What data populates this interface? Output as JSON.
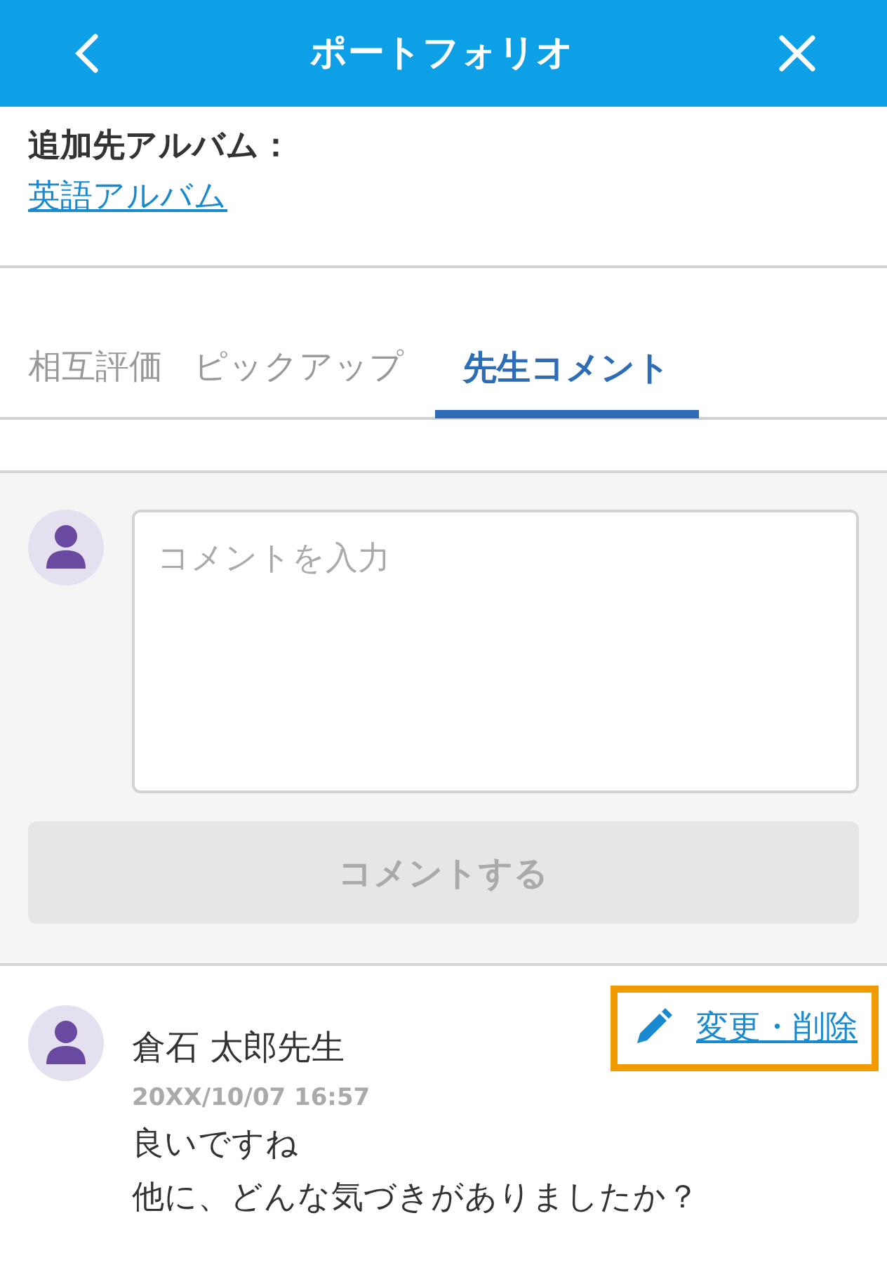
{
  "header": {
    "title": "ポートフォリオ"
  },
  "album": {
    "label": "追加先アルバム：",
    "link": "英語アルバム"
  },
  "tabs": [
    {
      "label": "相互評価",
      "selected": false
    },
    {
      "label": "ピックアップ",
      "selected": false
    },
    {
      "label": "先生コメント",
      "selected": true
    }
  ],
  "comment_form": {
    "placeholder": "コメントを入力",
    "submit": "コメントする",
    "submit_disabled": true
  },
  "comments": [
    {
      "author": "倉石 太郎先生",
      "date": "20XX/10/07 16:57",
      "edit_link": "変更・削除",
      "edit_highlighted": true,
      "lines": [
        "良いですね",
        "他に、どんな気づきがありましたか？"
      ]
    }
  ]
}
